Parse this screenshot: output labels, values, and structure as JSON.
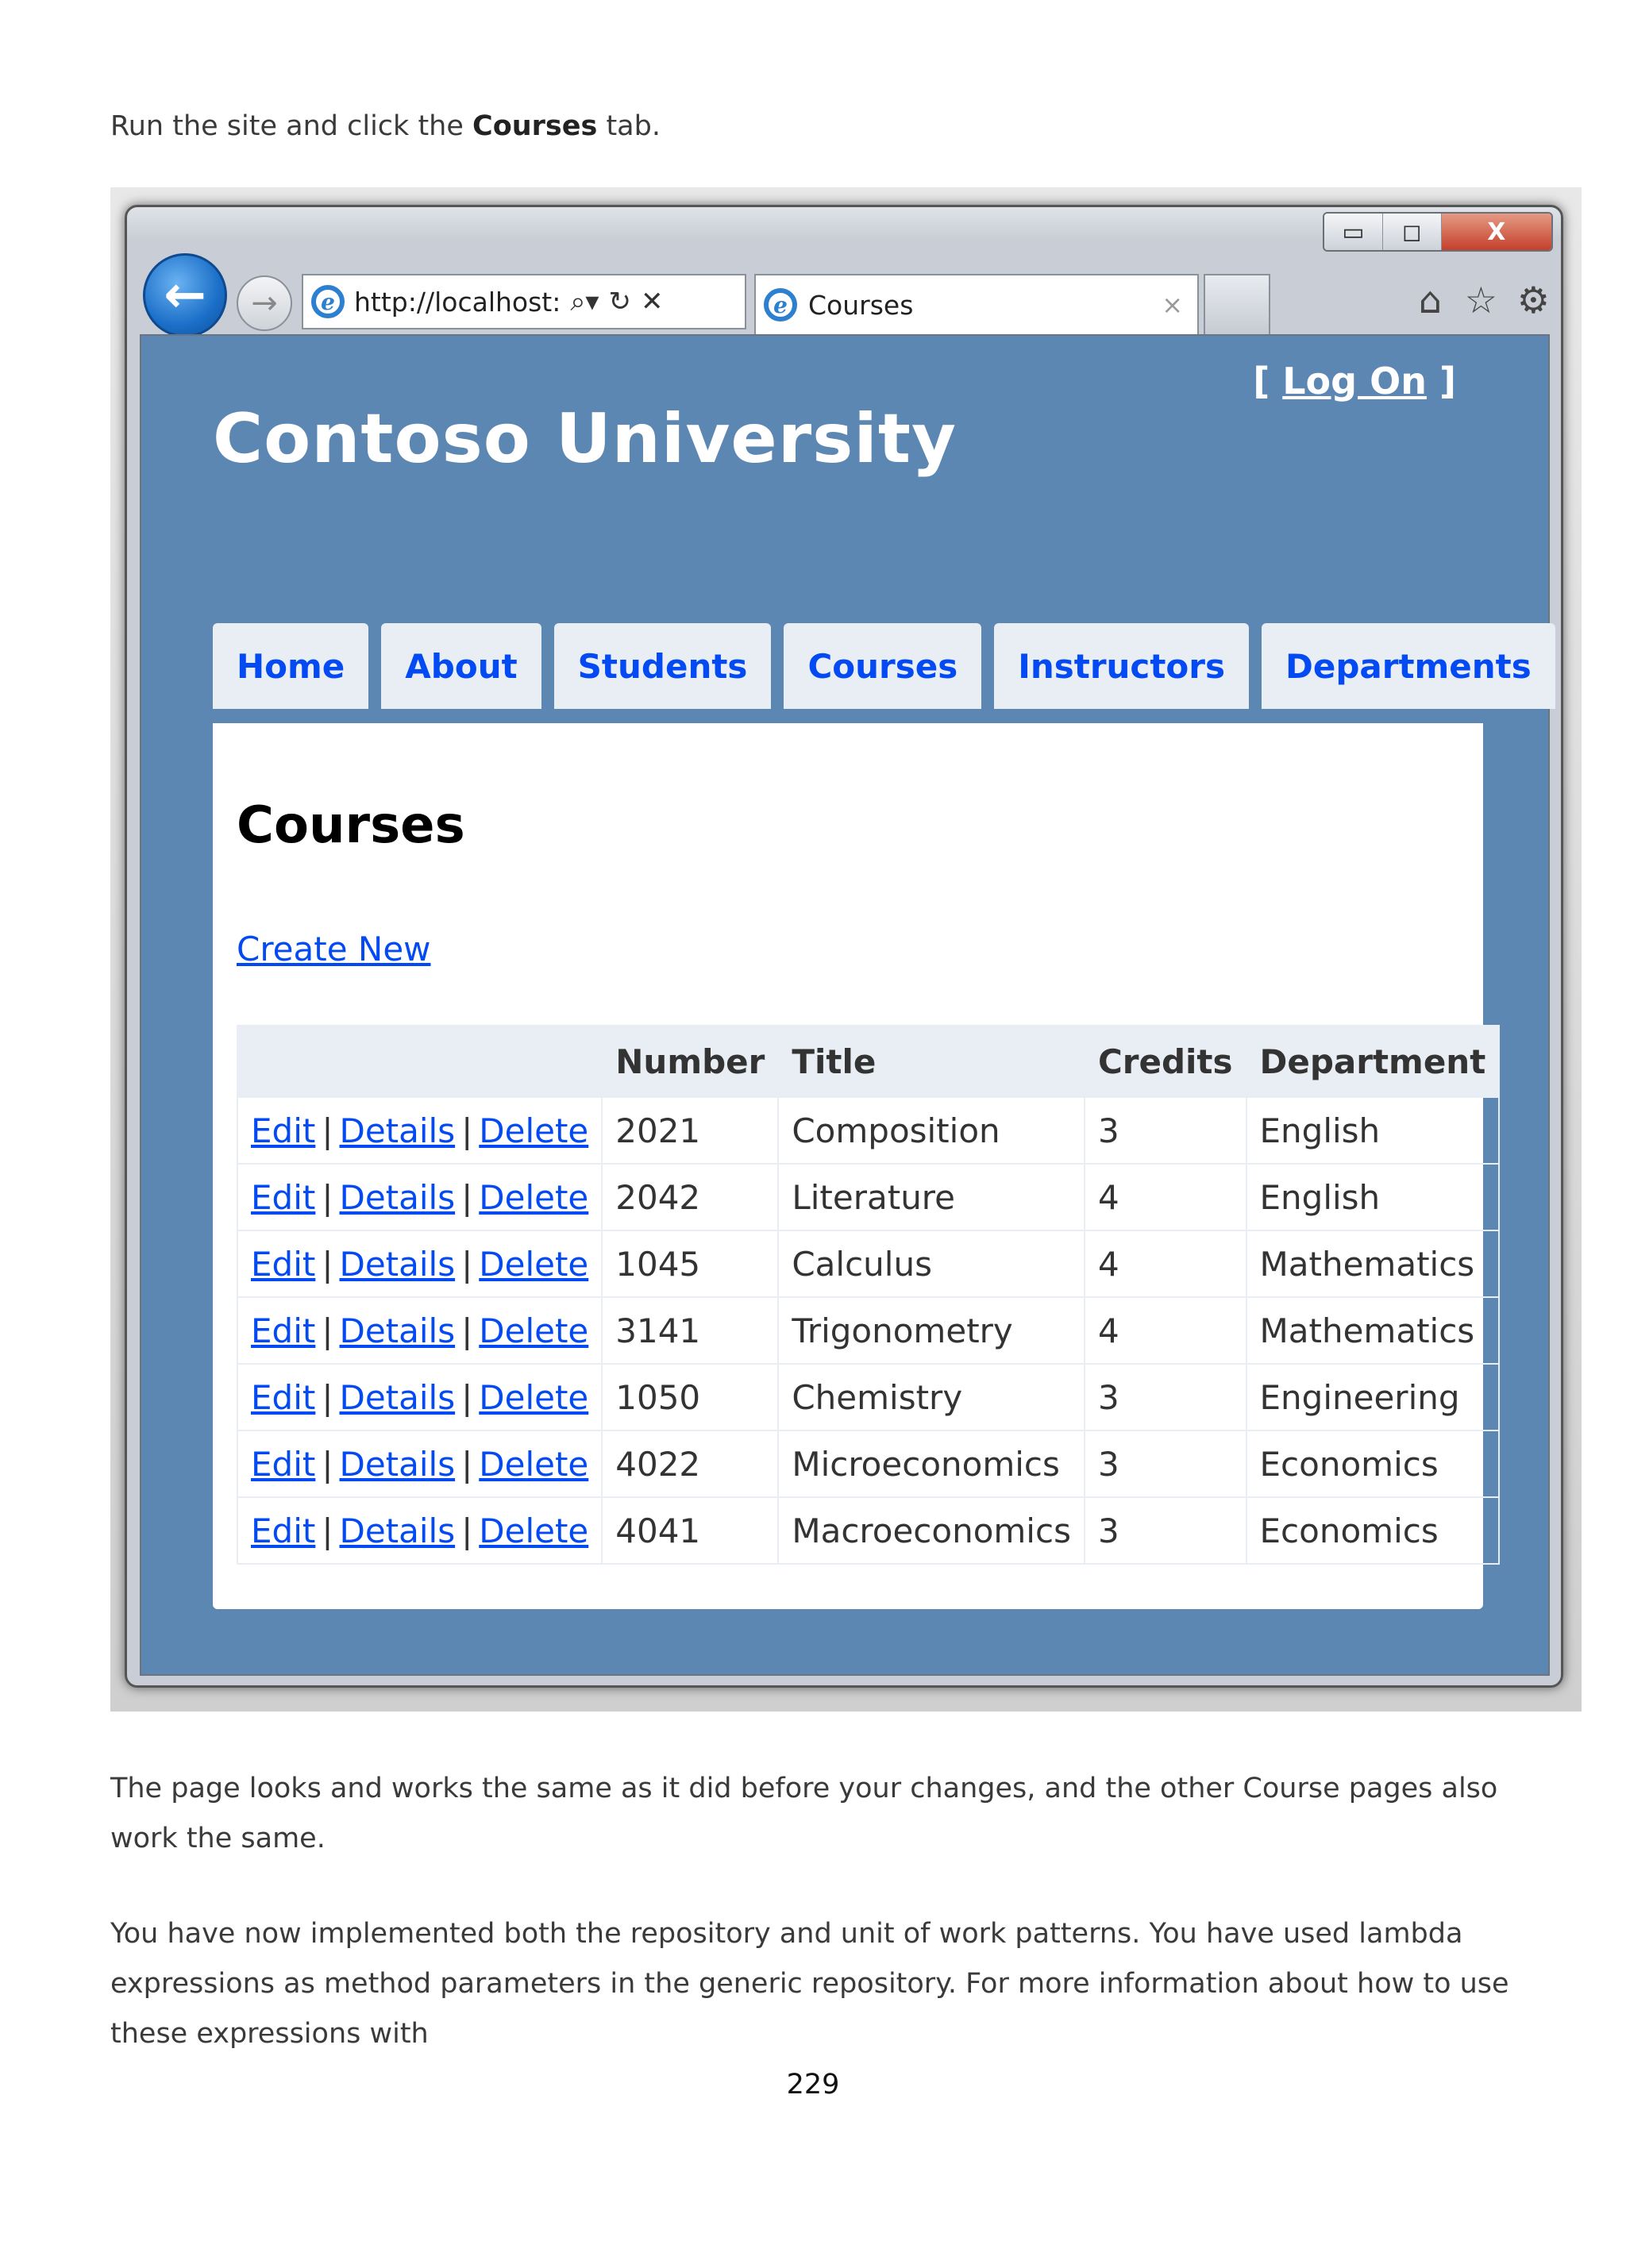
{
  "doc": {
    "intro_prefix": "Run the site and click the ",
    "intro_bold": "Courses",
    "intro_suffix": " tab.",
    "para1": "The page looks and works the same as it did before your changes, and the other Course pages also work the same.",
    "para2": "You have now implemented both the repository and unit of work patterns. You have used lambda expressions as method parameters in the generic repository. For more information about how to use these expressions with",
    "page_number": "229"
  },
  "browser": {
    "address": "http://localhost:",
    "tab_title": "Courses",
    "tab_close": "×",
    "back": "←",
    "forward": "→",
    "min": "▭",
    "restore": "◻",
    "close": "X"
  },
  "site": {
    "title": "Contoso University",
    "login_open": "[ ",
    "login_link": "Log On",
    "login_close": " ]",
    "nav": [
      "Home",
      "About",
      "Students",
      "Courses",
      "Instructors",
      "Departments"
    ],
    "heading": "Courses",
    "create_new": "Create New",
    "columns": [
      "",
      "Number",
      "Title",
      "Credits",
      "Department"
    ],
    "actions": {
      "edit": "Edit",
      "details": "Details",
      "delete": "Delete",
      "sep": "|"
    },
    "rows": [
      {
        "number": "2021",
        "title": "Composition",
        "credits": "3",
        "department": "English"
      },
      {
        "number": "2042",
        "title": "Literature",
        "credits": "4",
        "department": "English"
      },
      {
        "number": "1045",
        "title": "Calculus",
        "credits": "4",
        "department": "Mathematics"
      },
      {
        "number": "3141",
        "title": "Trigonometry",
        "credits": "4",
        "department": "Mathematics"
      },
      {
        "number": "1050",
        "title": "Chemistry",
        "credits": "3",
        "department": "Engineering"
      },
      {
        "number": "4022",
        "title": "Microeconomics",
        "credits": "3",
        "department": "Economics"
      },
      {
        "number": "4041",
        "title": "Macroeconomics",
        "credits": "3",
        "department": "Economics"
      }
    ]
  },
  "icons": {
    "home": "home-icon",
    "favorites": "star-icon",
    "tools": "gear-icon",
    "ie": "ie-logo-icon"
  },
  "colors": {
    "site_bg": "#5c87b2",
    "link": "#034af3",
    "tab_bg": "#e8eef4"
  }
}
